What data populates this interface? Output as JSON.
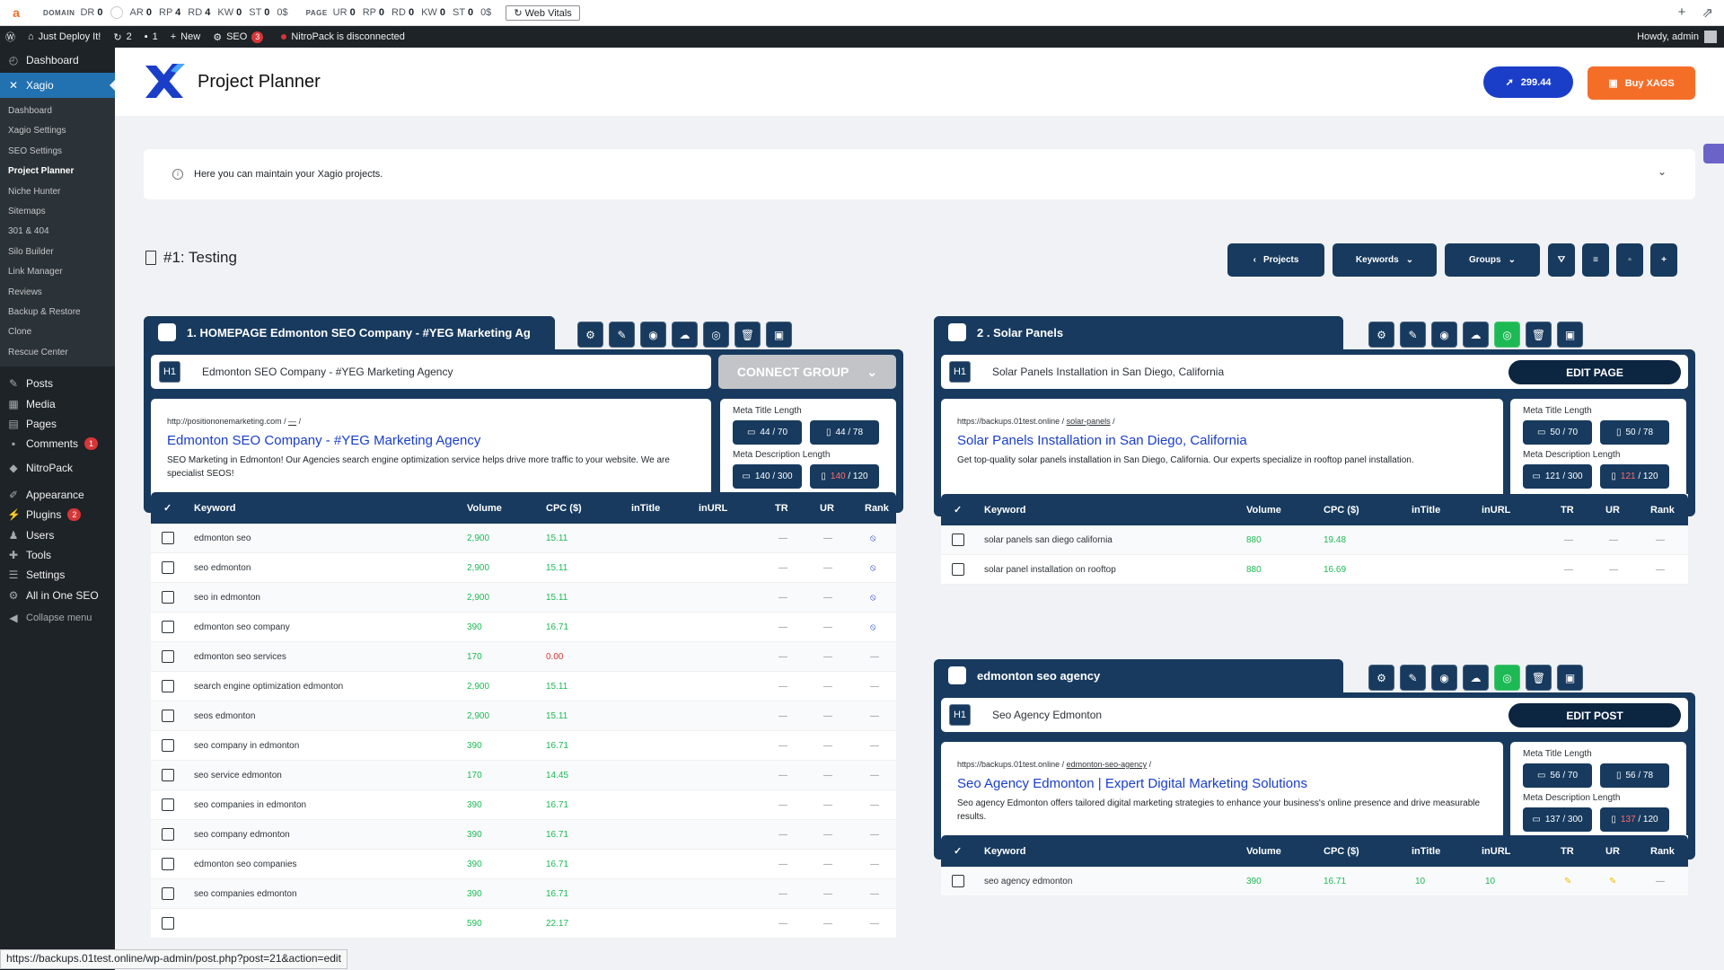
{
  "ext_bar": {
    "domain_label": "DOMAIN",
    "domain_metrics": [
      {
        "k": "DR",
        "v": "0"
      },
      {
        "k": "AR",
        "v": "0"
      },
      {
        "k": "RP",
        "v": "4"
      },
      {
        "k": "RD",
        "v": "4"
      },
      {
        "k": "KW",
        "v": "0"
      },
      {
        "k": "ST",
        "v": "0"
      }
    ],
    "domain_st_suffix": "0$",
    "page_label": "PAGE",
    "page_metrics": [
      {
        "k": "UR",
        "v": "0"
      },
      {
        "k": "RP",
        "v": "0"
      },
      {
        "k": "RD",
        "v": "0"
      },
      {
        "k": "KW",
        "v": "0"
      },
      {
        "k": "ST",
        "v": "0"
      }
    ],
    "page_st_suffix": "0$",
    "web_vitals": "Web Vitals"
  },
  "wp_bar": {
    "site": "Just Deploy It!",
    "updates": "2",
    "comments": "1",
    "new": "New",
    "seo": "SEO",
    "seo_badge": "3",
    "nitro": "NitroPack is disconnected",
    "howdy": "Howdy, admin"
  },
  "sidebar": {
    "top": [
      {
        "icon": "dashboard-icon",
        "label": "Dashboard"
      }
    ],
    "active": "Xagio",
    "sub": [
      "Dashboard",
      "Xagio Settings",
      "SEO Settings",
      "Project Planner",
      "Niche Hunter",
      "Sitemaps",
      "301 & 404",
      "Silo Builder",
      "Link Manager",
      "Reviews",
      "Backup & Restore",
      "Clone",
      "Rescue Center"
    ],
    "current_sub": "Project Planner",
    "items": [
      {
        "label": "Posts",
        "badge": ""
      },
      {
        "label": "Media",
        "badge": ""
      },
      {
        "label": "Pages",
        "badge": ""
      },
      {
        "label": "Comments",
        "badge": "1"
      },
      {
        "label": "NitroPack",
        "badge": ""
      },
      {
        "label": "Appearance",
        "badge": ""
      },
      {
        "label": "Plugins",
        "badge": "2"
      },
      {
        "label": "Users",
        "badge": ""
      },
      {
        "label": "Tools",
        "badge": ""
      },
      {
        "label": "Settings",
        "badge": ""
      },
      {
        "label": "All in One SEO",
        "badge": ""
      }
    ],
    "collapse": "Collapse menu"
  },
  "header": {
    "title": "Project Planner",
    "balance": "299.44",
    "buy": "Buy XAGS"
  },
  "info": {
    "text": "Here you can maintain your Xagio projects."
  },
  "project": {
    "title": "#1: Testing"
  },
  "toolbar": {
    "projects": "Projects",
    "keywords": "Keywords",
    "groups": "Groups"
  },
  "groups": [
    {
      "name": "1. HOMEPAGE Edmonton SEO Company - #YEG Marketing Ag",
      "h1": "Edmonton SEO Company - #YEG Marketing Agency",
      "action": "CONNECT GROUP",
      "url_base": "http://positiononemarketing.com /",
      "url_slug": "—",
      "url_end": " /",
      "serp_title": "Edmonton SEO Company - #YEG Marketing Agency",
      "serp_desc": "SEO Marketing in Edmonton! Our Agencies search engine optimization service helps drive more traffic to your website. We are specialist SEOS!",
      "meta_title_label": "Meta Title Length",
      "meta_desc_label": "Meta Description Length",
      "mt_desktop": "44 / 70",
      "mt_mobile": "44 / 78",
      "md_desktop": "140 / 300",
      "md_mobile_a": "140",
      "md_mobile_b": " / 120",
      "cols": [
        "Keyword",
        "Volume",
        "CPC ($)",
        "inTitle",
        "inURL",
        "TR",
        "UR",
        "Rank"
      ],
      "rows": [
        {
          "k": "edmonton seo",
          "v": "2,900",
          "c": "15.11",
          "t": "",
          "u": "",
          "tr": "—",
          "ur": "—",
          "rk": "⦸"
        },
        {
          "k": "seo edmonton",
          "v": "2,900",
          "c": "15.11",
          "t": "",
          "u": "",
          "tr": "—",
          "ur": "—",
          "rk": "⦸"
        },
        {
          "k": "seo in edmonton",
          "v": "2,900",
          "c": "15.11",
          "t": "",
          "u": "",
          "tr": "—",
          "ur": "—",
          "rk": "⦸"
        },
        {
          "k": "edmonton seo company",
          "v": "390",
          "c": "16.71",
          "t": "",
          "u": "",
          "tr": "—",
          "ur": "—",
          "rk": "⦸"
        },
        {
          "k": "edmonton seo services",
          "v": "170",
          "c": "0.00",
          "t": "",
          "u": "",
          "tr": "—",
          "ur": "—",
          "rk": "—"
        },
        {
          "k": "search engine optimization edmonton",
          "v": "2,900",
          "c": "15.11",
          "t": "",
          "u": "",
          "tr": "—",
          "ur": "—",
          "rk": "—"
        },
        {
          "k": "seos edmonton",
          "v": "2,900",
          "c": "15.11",
          "t": "",
          "u": "",
          "tr": "—",
          "ur": "—",
          "rk": "—"
        },
        {
          "k": "seo company in edmonton",
          "v": "390",
          "c": "16.71",
          "t": "",
          "u": "",
          "tr": "—",
          "ur": "—",
          "rk": "—"
        },
        {
          "k": "seo service edmonton",
          "v": "170",
          "c": "14.45",
          "t": "",
          "u": "",
          "tr": "—",
          "ur": "—",
          "rk": "—"
        },
        {
          "k": "seo companies in edmonton",
          "v": "390",
          "c": "16.71",
          "t": "",
          "u": "",
          "tr": "—",
          "ur": "—",
          "rk": "—"
        },
        {
          "k": "seo company edmonton",
          "v": "390",
          "c": "16.71",
          "t": "",
          "u": "",
          "tr": "—",
          "ur": "—",
          "rk": "—"
        },
        {
          "k": "edmonton seo companies",
          "v": "390",
          "c": "16.71",
          "t": "",
          "u": "",
          "tr": "—",
          "ur": "—",
          "rk": "—"
        },
        {
          "k": "seo companies edmonton",
          "v": "390",
          "c": "16.71",
          "t": "",
          "u": "",
          "tr": "—",
          "ur": "—",
          "rk": "—"
        },
        {
          "k": "",
          "v": "590",
          "c": "22.17",
          "t": "",
          "u": "",
          "tr": "—",
          "ur": "—",
          "rk": "—"
        }
      ]
    },
    {
      "name": "2 . Solar Panels",
      "h1": "Solar Panels Installation in San Diego, California",
      "action": "EDIT PAGE",
      "url_base": "https://backups.01test.online /",
      "url_slug": "solar-panels",
      "url_end": " /",
      "serp_title": "Solar Panels Installation in San Diego, California",
      "serp_desc": "Get top-quality solar panels installation in San Diego, California. Our experts specialize in rooftop panel installation.",
      "meta_title_label": "Meta Title Length",
      "meta_desc_label": "Meta Description Length",
      "mt_desktop": "50 / 70",
      "mt_mobile": "50 / 78",
      "md_desktop": "121 / 300",
      "md_mobile_a": "121",
      "md_mobile_b": " / 120",
      "cols": [
        "Keyword",
        "Volume",
        "CPC ($)",
        "inTitle",
        "inURL",
        "TR",
        "UR",
        "Rank"
      ],
      "rows": [
        {
          "k": "solar panels san diego california",
          "v": "880",
          "c": "19.48",
          "t": "",
          "u": "",
          "tr": "—",
          "ur": "—",
          "rk": "—"
        },
        {
          "k": "solar panel installation on rooftop",
          "v": "880",
          "c": "16.69",
          "t": "",
          "u": "",
          "tr": "—",
          "ur": "—",
          "rk": "—"
        }
      ]
    },
    {
      "name": "edmonton seo agency",
      "h1": "Seo Agency Edmonton",
      "action": "EDIT POST",
      "url_base": "https://backups.01test.online /",
      "url_slug": "edmonton-seo-agency",
      "url_end": " /",
      "serp_title": "Seo Agency Edmonton | Expert Digital Marketing Solutions",
      "serp_desc": "Seo agency Edmonton offers tailored digital marketing strategies to enhance your business's online presence and drive measurable results.",
      "meta_title_label": "Meta Title Length",
      "meta_desc_label": "Meta Description Length",
      "mt_desktop": "56 / 70",
      "mt_mobile": "56 / 78",
      "md_desktop": "137 / 300",
      "md_mobile_a": "137",
      "md_mobile_b": " / 120",
      "cols": [
        "Keyword",
        "Volume",
        "CPC ($)",
        "inTitle",
        "inURL",
        "TR",
        "UR",
        "Rank"
      ],
      "rows": [
        {
          "k": "seo agency edmonton",
          "v": "390",
          "c": "16.71",
          "t": "10",
          "u": "10",
          "tr": "✎",
          "ur": "✎",
          "rk": "—"
        }
      ]
    }
  ],
  "status_url": "https://backups.01test.online/wp-admin/post.php?post=21&action=edit",
  "colors": {
    "navy": "#173a5e",
    "accent_blue": "#1a3ec8",
    "orange": "#f56e28",
    "green": "#1db954"
  }
}
